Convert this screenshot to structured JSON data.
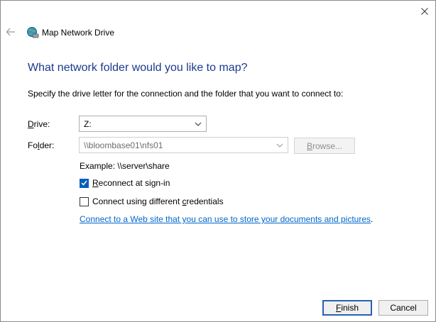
{
  "window": {
    "title": "Map Network Drive",
    "close_glyph": "✕",
    "back_glyph": "←"
  },
  "main": {
    "heading": "What network folder would you like to map?",
    "instruction": "Specify the drive letter for the connection and the folder that you want to connect to:",
    "drive": {
      "label_before": "",
      "label_access_key": "D",
      "label_after": "rive:",
      "value": "Z:"
    },
    "folder": {
      "label_before": "Fo",
      "label_access_key": "l",
      "label_after": "der:",
      "value": "\\\\bloombase01\\nfs01"
    },
    "browse_before": "",
    "browse_access_key": "B",
    "browse_after": "rowse...",
    "example": "Example: \\\\server\\share",
    "reconnect": {
      "checked": true,
      "label_before": "",
      "label_access_key": "R",
      "label_after": "econnect at sign-in"
    },
    "creds": {
      "checked": false,
      "label_before": "Connect using different ",
      "label_access_key": "c",
      "label_after": "redentials"
    },
    "web_link": {
      "text": "Connect to a Web site that you can use to store your documents and pictures",
      "suffix": "."
    }
  },
  "footer": {
    "finish_before": "",
    "finish_access_key": "F",
    "finish_after": "inish",
    "cancel_label": "Cancel"
  },
  "colors": {
    "heading": "#1a3a8f",
    "link": "#0066cc",
    "accent": "#005fb8"
  },
  "icons": {
    "title_icon": "network-drive-icon",
    "back_icon": "back-arrow-icon",
    "close_icon": "close-icon",
    "dropdown_icon": "chevron-down-icon",
    "check_icon": "checkmark-icon"
  }
}
